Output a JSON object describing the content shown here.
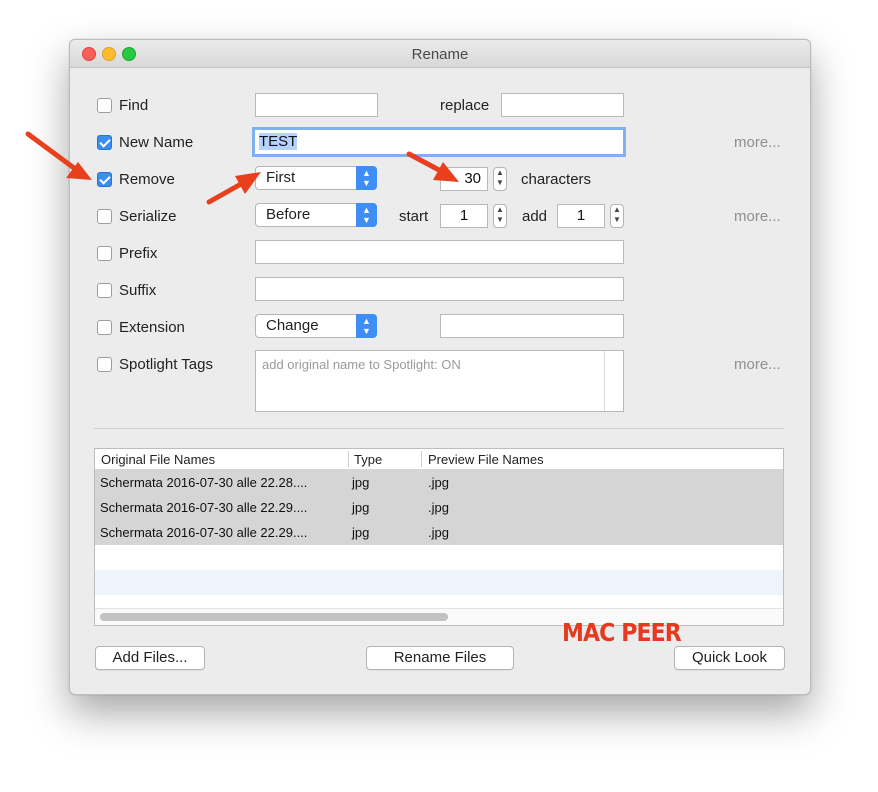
{
  "window": {
    "title": "Rename"
  },
  "options": {
    "find": {
      "label": "Find",
      "checked": false,
      "value": ""
    },
    "replace": {
      "label": "replace",
      "value": ""
    },
    "new_name": {
      "label": "New Name",
      "checked": true,
      "value": "TEST"
    },
    "remove": {
      "label": "Remove",
      "checked": true,
      "position": "First",
      "count": "30",
      "unit_label": "characters"
    },
    "serialize": {
      "label": "Serialize",
      "checked": false,
      "position": "Before",
      "start_label": "start",
      "start_value": "1",
      "add_label": "add",
      "add_value": "1"
    },
    "prefix": {
      "label": "Prefix",
      "checked": false,
      "value": ""
    },
    "suffix": {
      "label": "Suffix",
      "checked": false,
      "value": ""
    },
    "extension": {
      "label": "Extension",
      "checked": false,
      "mode": "Change",
      "value": ""
    },
    "spotlight": {
      "label": "Spotlight Tags",
      "checked": false,
      "placeholder": "add original name to Spotlight: ON"
    },
    "more_label": "more..."
  },
  "table": {
    "columns": [
      "Original File Names",
      "Type",
      "Preview File Names"
    ],
    "rows": [
      [
        "Schermata 2016-07-30 alle 22.28....",
        "jpg",
        ".jpg"
      ],
      [
        "Schermata 2016-07-30 alle 22.29....",
        "jpg",
        ".jpg"
      ],
      [
        "Schermata 2016-07-30 alle 22.29....",
        "jpg",
        ".jpg"
      ]
    ]
  },
  "buttons": {
    "add_files": "Add Files...",
    "rename_files": "Rename Files",
    "quick_look": "Quick Look"
  },
  "watermark": "MAC PEER",
  "colors": {
    "accent": "#3f8ef5",
    "annotation_arrow": "#e8401c",
    "watermark": "#e53a1f"
  }
}
